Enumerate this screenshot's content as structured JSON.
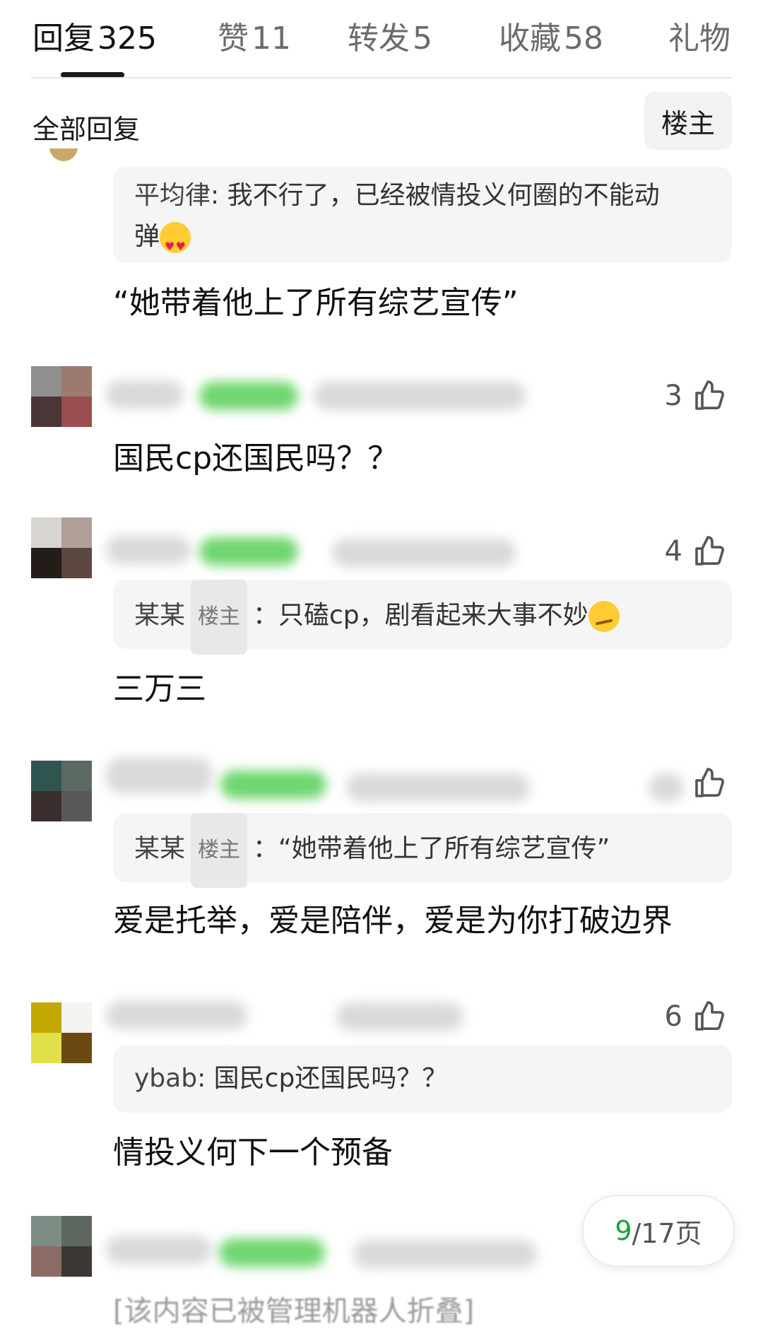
{
  "tabs": [
    {
      "label": "回复",
      "count": "325"
    },
    {
      "label": "赞",
      "count": "11"
    },
    {
      "label": "转发",
      "count": "5"
    },
    {
      "label": "收藏",
      "count": "58"
    },
    {
      "label": "礼物",
      "count": ""
    }
  ],
  "filter": {
    "all_label": "全部回复",
    "owner_button": "楼主"
  },
  "items": [
    {
      "quote_author": "平均律",
      "quote_text": "我不行了，已经被情投义何圈的不能动",
      "quote_text2": "弹",
      "reply": "“她带着他上了所有综艺宣传”"
    },
    {
      "likes": "3",
      "reply": "国民cp还国民吗？？"
    },
    {
      "likes": "4",
      "quote_author": "某某",
      "quote_tag": "楼主",
      "quote_text": "：只磕cp，剧看起来大事不妙",
      "reply": "三万三"
    },
    {
      "likes": "",
      "quote_author": "某某",
      "quote_tag": "楼主",
      "quote_text": "：“她带着他上了所有综艺宣传”",
      "reply": "爱是托举，爱是陪伴，爱是为你打破边界"
    },
    {
      "likes": "6",
      "quote_author": "ybab",
      "quote_text": "国民cp还国民吗？？",
      "reply": "情投义何下一个预备"
    }
  ],
  "pager": {
    "current": "9",
    "total_label": "/17页"
  },
  "bottom_partial": "[该内容已被管理机器人折叠]",
  "icons": {
    "like": "thumbs-up-icon"
  },
  "colors": {
    "accent_green": "#1aa33a"
  }
}
